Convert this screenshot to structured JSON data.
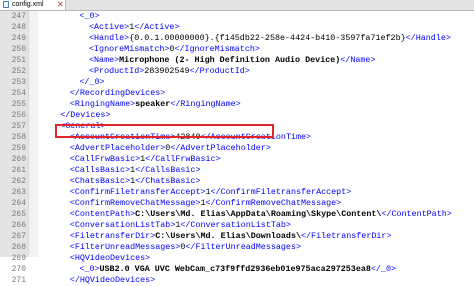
{
  "tab": {
    "filename": "config.xml",
    "close_glyph": "✕"
  },
  "colors": {
    "tag": "#0000ff",
    "text": "#000000",
    "highlight": "#e0262b"
  },
  "lines": [
    {
      "num": "247",
      "indent": 4,
      "open": "<_0>",
      "text": "",
      "close": ""
    },
    {
      "num": "248",
      "indent": 5,
      "open": "<Active>",
      "text": "1",
      "close": "</Active>"
    },
    {
      "num": "249",
      "indent": 5,
      "open": "<Handle>",
      "text": "{0.0.1.00000000}.{f145db22-258e-4424-b410-3597fa71ef2b}",
      "close": "</Handle>"
    },
    {
      "num": "250",
      "indent": 5,
      "open": "<IgnoreMismatch>",
      "text": "0",
      "close": "</IgnoreMismatch>"
    },
    {
      "num": "251",
      "indent": 5,
      "open": "<Name>",
      "text": "Microphone (2- High Definition Audio Device)",
      "close": "</Name>",
      "strong": true
    },
    {
      "num": "252",
      "indent": 5,
      "open": "<ProductId>",
      "text": "283902549",
      "close": "</ProductId>"
    },
    {
      "num": "253",
      "indent": 4,
      "open": "",
      "text": "",
      "close": "</_0>"
    },
    {
      "num": "254",
      "indent": 3,
      "open": "",
      "text": "",
      "close": "</RecordingDevices>"
    },
    {
      "num": "255",
      "indent": 3,
      "open": "<RingingName>",
      "text": "speaker",
      "close": "</RingingName>",
      "strong": true
    },
    {
      "num": "256",
      "indent": 2,
      "open": "",
      "text": "",
      "close": "</Devices>"
    },
    {
      "num": "257",
      "indent": 2,
      "open": "<General>",
      "text": "",
      "close": ""
    },
    {
      "num": "258",
      "indent": 3,
      "open": "<AccountCreationTime>",
      "text": "42840",
      "close": "</AccountCreationTime>"
    },
    {
      "num": "259",
      "indent": 3,
      "open": "<AdvertPlaceholder>",
      "text": "0",
      "close": "</AdvertPlaceholder>",
      "highlight": true
    },
    {
      "num": "260",
      "indent": 3,
      "open": "<CallFrwBasic>",
      "text": "1",
      "close": "</CallFrwBasic>"
    },
    {
      "num": "261",
      "indent": 3,
      "open": "<CallsBasic>",
      "text": "1",
      "close": "</CallsBasic>"
    },
    {
      "num": "262",
      "indent": 3,
      "open": "<ChatsBasic>",
      "text": "1",
      "close": "</ChatsBasic>"
    },
    {
      "num": "263",
      "indent": 3,
      "open": "<ConfirmFiletransferAccept>",
      "text": "1",
      "close": "</ConfirmFiletransferAccept>"
    },
    {
      "num": "264",
      "indent": 3,
      "open": "<ConfirmRemoveChatMessage>",
      "text": "1",
      "close": "</ConfirmRemoveChatMessage>"
    },
    {
      "num": "265",
      "indent": 3,
      "open": "<ContentPath>",
      "text": "C:\\Users\\Md. Elias\\AppData\\Roaming\\Skype\\Content\\",
      "close": "</ContentPath>",
      "strong": true
    },
    {
      "num": "266",
      "indent": 3,
      "open": "<ConversationListTab>",
      "text": "1",
      "close": "</ConversationListTab>"
    },
    {
      "num": "267",
      "indent": 3,
      "open": "<FiletransferDir>",
      "text": "C:\\Users\\Md. Elias\\Downloads\\",
      "close": "</FiletransferDir>",
      "strong": true
    },
    {
      "num": "268",
      "indent": 3,
      "open": "<FilterUnreadMessages>",
      "text": "0",
      "close": "</FilterUnreadMessages>"
    },
    {
      "num": "269",
      "indent": 3,
      "open": "<HQVideoDevices>",
      "text": "",
      "close": ""
    },
    {
      "num": "270",
      "indent": 4,
      "open": "<_0>",
      "text": "USB2.0 VGA UVC WebCam_c73f9ffd2936eb01e975aca297253ea8",
      "close": "</_0>",
      "strong": true
    },
    {
      "num": "271",
      "indent": 3,
      "open": "",
      "text": "",
      "close": "</HQVideoDevices>"
    }
  ]
}
